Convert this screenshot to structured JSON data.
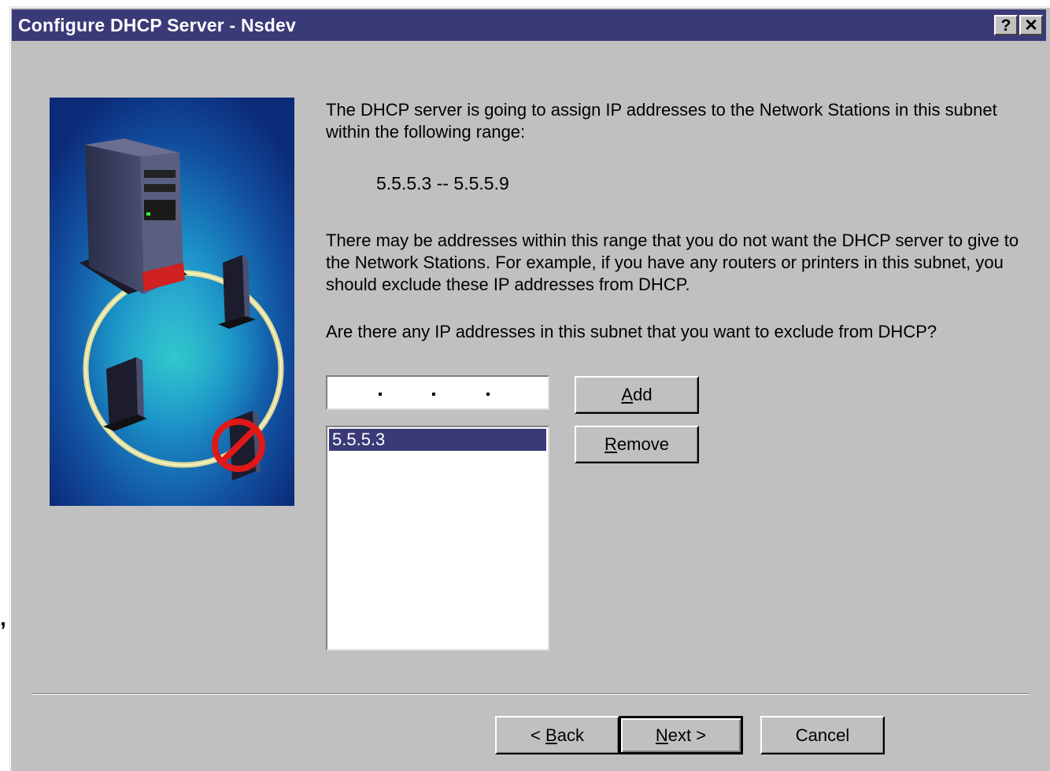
{
  "window": {
    "title": "Configure DHCP Server - Nsdev"
  },
  "titlebar_buttons": {
    "help": "?",
    "close": "✕"
  },
  "intro": "The DHCP server is going to assign IP addresses to the Network Stations in this subnet within the following range:",
  "range": "5.5.5.3 -- 5.5.5.9",
  "explanation": "There may be addresses within this range that you do not want the DHCP server to give to the Network Stations.  For example, if you have any routers or printers in this subnet, you should exclude these IP addresses from DHCP.",
  "question": "Are there any IP addresses in this subnet that you want to exclude from DHCP?",
  "ip_input": {
    "value": ""
  },
  "excluded_list": {
    "items": [
      "5.5.5.3"
    ],
    "selected": "5.5.5.3"
  },
  "buttons": {
    "add": {
      "mnemonic": "A",
      "rest": "dd"
    },
    "remove": {
      "mnemonic": "R",
      "rest": "emove"
    },
    "back": {
      "pre": "< ",
      "mnemonic": "B",
      "rest": "ack"
    },
    "next": {
      "mnemonic": "N",
      "rest": "ext >"
    },
    "cancel": "Cancel"
  },
  "stray_mark": ",",
  "colors": {
    "titlebar": "#3b3a78",
    "dialog": "#c0c0c0",
    "selection": "#3b3a78"
  },
  "illustration": {
    "icons": [
      "server-tower-icon",
      "network-station-icon",
      "prohibited-icon"
    ]
  }
}
